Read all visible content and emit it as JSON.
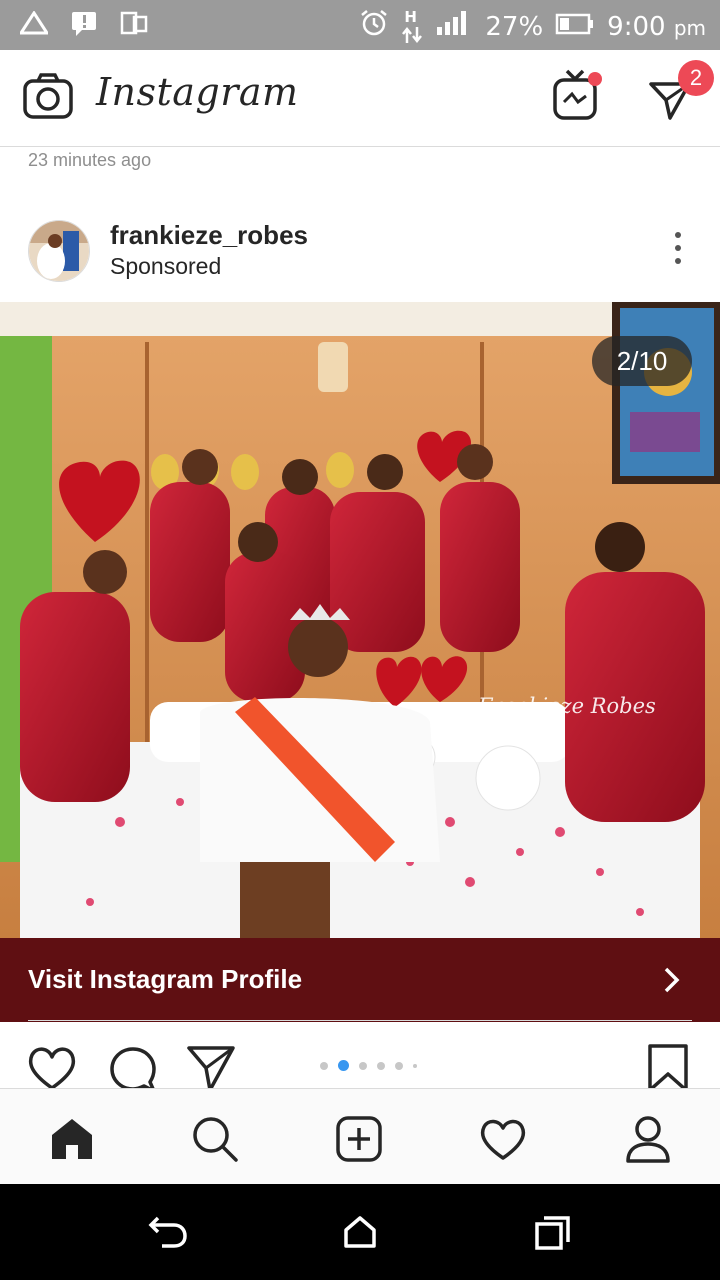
{
  "status_bar": {
    "battery": "27%",
    "time": "9:00",
    "ampm": "pm",
    "net_label": "H",
    "icons": [
      "alert-triangle-icon",
      "message-alert-icon",
      "multiscreen-icon",
      "alarm-icon",
      "data-arrows-icon",
      "signal-icon",
      "battery-icon"
    ]
  },
  "header": {
    "app_name": "Instagram",
    "camera_icon": "camera-icon",
    "igtv_icon": "igtv-icon",
    "direct_icon": "direct-message-icon",
    "direct_badge": "2"
  },
  "feed": {
    "previous_timestamp": "23 minutes ago"
  },
  "post": {
    "username": "frankieze_robes",
    "sponsored_label": "Sponsored",
    "image_counter": "2/10",
    "image_watermark": "Frankieze Robes",
    "current_slide": 2,
    "total_slides": 10,
    "cta_label": "Visit Instagram Profile",
    "cta_color": "#5f0f12"
  },
  "bottom_nav": {
    "items": [
      "home-icon",
      "search-icon",
      "add-post-icon",
      "activity-heart-icon",
      "profile-icon"
    ]
  },
  "colors": {
    "accent_red": "#ed4956",
    "statusbar_gray": "#9b9b9b",
    "cta_maroon": "#5f0f12"
  }
}
